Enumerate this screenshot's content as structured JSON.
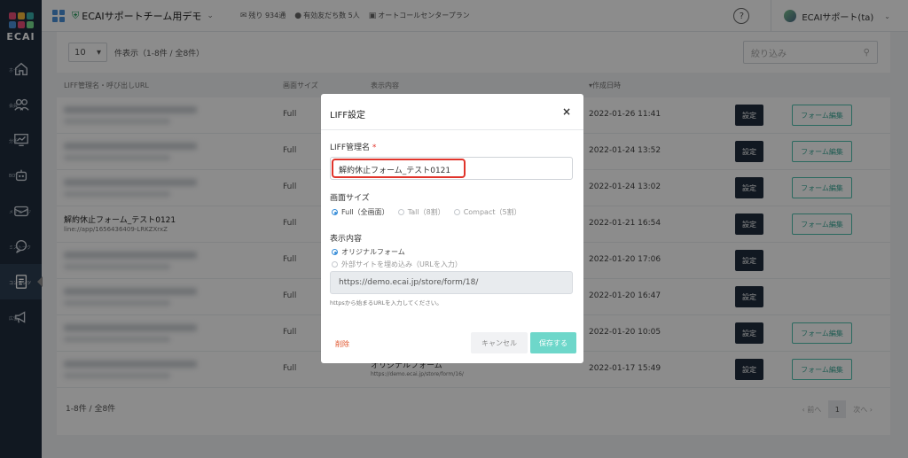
{
  "sidebar": {
    "logo_text": "ECAI",
    "items": [
      {
        "label": "ホーム",
        "icon": "home-icon"
      },
      {
        "label": "会員",
        "icon": "users-icon"
      },
      {
        "label": "分析",
        "icon": "chart-icon"
      },
      {
        "label": "BOT",
        "icon": "robot-icon"
      },
      {
        "label": "メッセージ",
        "icon": "message-icon"
      },
      {
        "label": "ミストーク",
        "icon": "chat-icon"
      },
      {
        "label": "コンテンツ",
        "icon": "content-icon",
        "active": true
      },
      {
        "label": "広告",
        "icon": "megaphone-icon"
      }
    ]
  },
  "header": {
    "account_name": "ECAIサポートチーム用デモ",
    "remaining": "残り 934通",
    "friends": "有効友だち数 5人",
    "plan": "オートコールセンタープラン",
    "user_name": "ECAIサポート(ta)"
  },
  "toolbar": {
    "per_page": "10",
    "per_page_suffix": "件表示（1-8件 / 全8件）",
    "filter_placeholder": "絞り込み"
  },
  "table": {
    "columns": [
      "LIFF管理名・呼び出しURL",
      "画面サイズ",
      "表示内容",
      "作成日時"
    ],
    "rows": [
      {
        "name": "",
        "url": "",
        "size": "Full",
        "content": "",
        "content_url": "",
        "date": "2022-01-26 11:41",
        "set": "設定",
        "form": "フォーム編集"
      },
      {
        "name": "",
        "url": "",
        "size": "Full",
        "content": "",
        "content_url": "",
        "date": "2022-01-24 13:52",
        "set": "設定",
        "form": "フォーム編集"
      },
      {
        "name": "",
        "url": "",
        "size": "Full",
        "content": "",
        "content_url": "",
        "date": "2022-01-24 13:02",
        "set": "設定",
        "form": "フォーム編集"
      },
      {
        "name": "解約休止フォーム_テスト0121",
        "url": "line://app/1656436409-LRKZXrxZ",
        "size": "Full",
        "content": "",
        "content_url": "",
        "date": "2022-01-21 16:54",
        "set": "設定",
        "form": "フォーム編集"
      },
      {
        "name": "",
        "url": "",
        "size": "Full",
        "content": "",
        "content_url": "",
        "date": "2022-01-20 17:06",
        "set": "設定",
        "form": ""
      },
      {
        "name": "",
        "url": "",
        "size": "Full",
        "content": "",
        "content_url": "",
        "date": "2022-01-20 16:47",
        "set": "設定",
        "form": ""
      },
      {
        "name": "",
        "url": "",
        "size": "Full",
        "content": "",
        "content_url": "",
        "date": "2022-01-20 10:05",
        "set": "設定",
        "form": "フォーム編集"
      },
      {
        "name": "",
        "url": "",
        "size": "Full",
        "content": "オリジナルフォーム",
        "content_url": "https://demo.ecai.jp/store/form/16/",
        "date": "2022-01-17 15:49",
        "set": "設定",
        "form": "フォーム編集"
      }
    ],
    "footer_count": "1-8件 / 全8件",
    "prev": "‹ 前へ",
    "page": "1",
    "next": "次へ ›"
  },
  "modal": {
    "title": "LIFF設定",
    "close": "×",
    "name_label": "LIFF管理名",
    "required_mark": "*",
    "name_value": "解約休止フォーム_テスト0121",
    "size_label": "画面サイズ",
    "size_options": [
      "Full（全画面）",
      "Tall（8割）",
      "Compact（5割）"
    ],
    "size_selected": "Full（全画面）",
    "content_label": "表示内容",
    "content_options": [
      "オリジナルフォーム",
      "外部サイトを埋め込み（URLを入力）"
    ],
    "content_selected": "オリジナルフォーム",
    "url_value": "https://demo.ecai.jp/store/form/18/",
    "url_help": "httpsから始まるURLを入力してください。",
    "delete": "削除",
    "cancel": "キャンセル",
    "save": "保存する"
  },
  "colors": {
    "sidebar_bg": "#1f2d3d",
    "accent_teal": "#4dbfae",
    "danger": "#e0342b",
    "radio_blue": "#3a8fd9"
  }
}
